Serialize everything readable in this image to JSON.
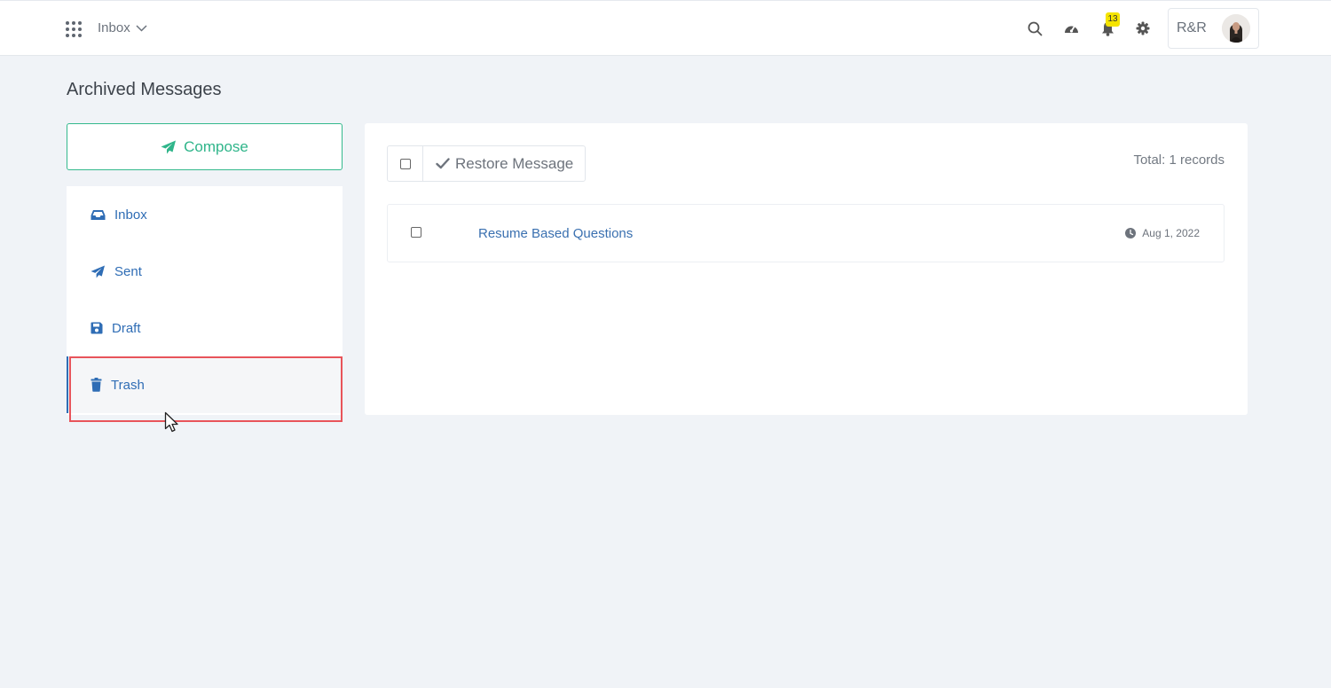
{
  "topbar": {
    "module_label": "Inbox",
    "notification_count": "13",
    "user_label": "R&R",
    "icons": [
      "apps-grid-icon",
      "search-icon",
      "dashboard-gauge-icon",
      "bell-icon",
      "gear-icon",
      "chevron-down-icon"
    ]
  },
  "page": {
    "title": "Archived Messages"
  },
  "sidebar": {
    "compose_label": "Compose",
    "items": [
      {
        "label": "Inbox",
        "icon": "inbox-tray-icon"
      },
      {
        "label": "Sent",
        "icon": "paper-plane-icon"
      },
      {
        "label": "Draft",
        "icon": "floppy-disk-icon"
      },
      {
        "label": "Trash",
        "icon": "trash-icon",
        "active": true
      }
    ]
  },
  "main": {
    "restore_label": "Restore Message",
    "total_label": "Total: 1 records",
    "messages": [
      {
        "subject": "Resume Based Questions",
        "date": "Aug 1, 2022"
      }
    ]
  },
  "colors": {
    "accent_green": "#2fb58a",
    "link_blue": "#2f6db5",
    "badge_yellow": "#f5e400",
    "highlight_red": "#e8545a",
    "page_bg": "#f0f3f7"
  }
}
